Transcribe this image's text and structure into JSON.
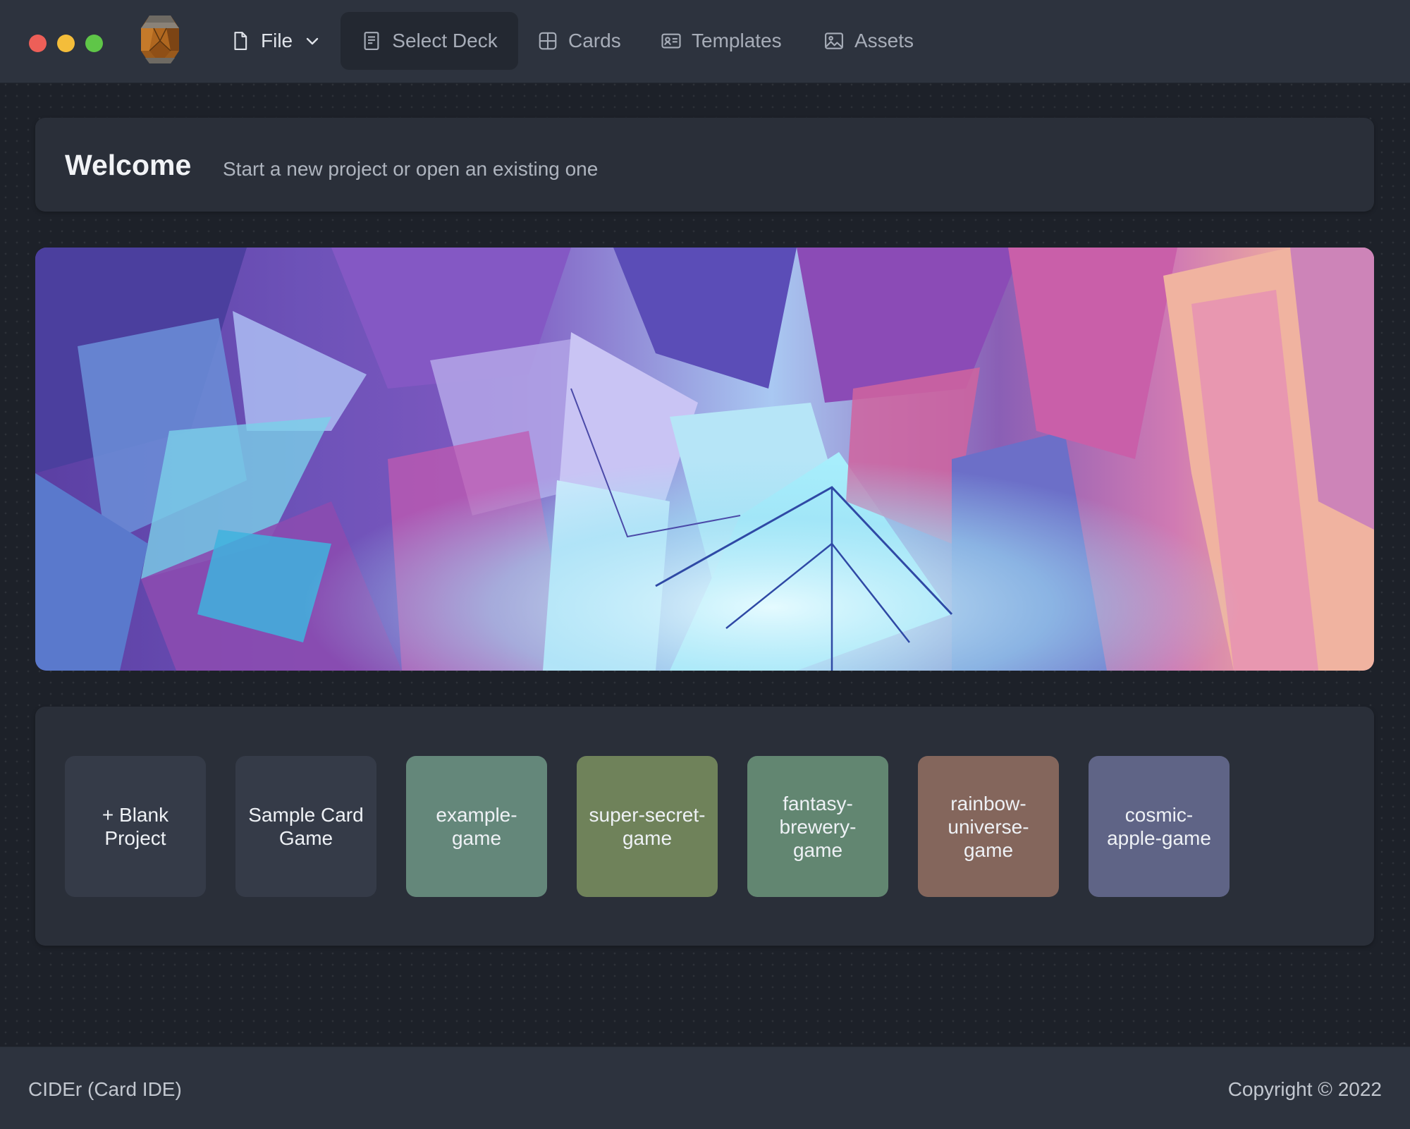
{
  "window": {
    "controls": [
      "close",
      "minimize",
      "maximize"
    ],
    "logo_icon": "barrel-logo-icon"
  },
  "nav": {
    "file": {
      "label": "File",
      "icon": "file-icon"
    },
    "items": [
      {
        "label": "Select Deck",
        "icon": "deck-icon",
        "active": true
      },
      {
        "label": "Cards",
        "icon": "grid-icon",
        "active": false
      },
      {
        "label": "Templates",
        "icon": "id-card-icon",
        "active": false
      },
      {
        "label": "Assets",
        "icon": "image-icon",
        "active": false
      }
    ]
  },
  "welcome": {
    "title": "Welcome",
    "subtitle": "Start a new project or open an existing one"
  },
  "banner": {
    "description_icon": "crystal-banner-image"
  },
  "projects": [
    {
      "label": "+ Blank Project",
      "color": "#353b48"
    },
    {
      "label": "Sample Card Game",
      "color": "#353b48"
    },
    {
      "label": "example-game",
      "color": "#64877a"
    },
    {
      "label": "super-secret-game",
      "color": "#6f825a"
    },
    {
      "label": "fantasy-brewery-game",
      "color": "#628671"
    },
    {
      "label": "rainbow-universe-game",
      "color": "#84665c"
    },
    {
      "label": "cosmic-apple-game",
      "color": "#5f6486"
    }
  ],
  "footer": {
    "left": "CIDEr (Card IDE)",
    "right": "Copyright © 2022"
  },
  "colors": {
    "accent_bg": "#2d333e",
    "panel_bg": "#2a2f39",
    "window_bg": "#1d2129"
  }
}
